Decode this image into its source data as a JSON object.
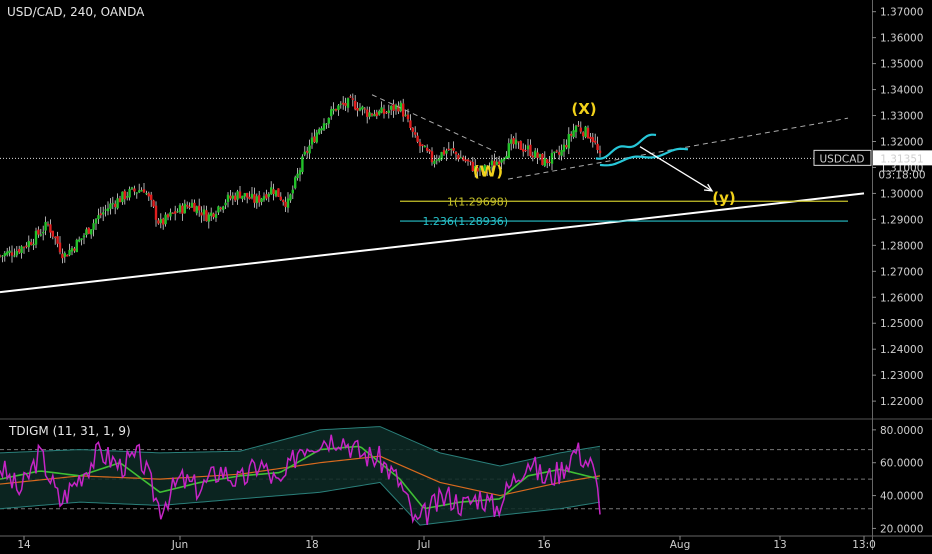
{
  "header": {
    "symbol_line": "USD/CAD, 240, OANDA"
  },
  "price_tag": {
    "symbol": "USDCAD",
    "value": "1.31351",
    "countdown": "03:18:00"
  },
  "oscillator": {
    "label": "TDIGM (11, 31, 1, 9)"
  },
  "colors": {
    "background": "#000000",
    "up_candle": "#22c12a",
    "down_candle": "#e01e1e",
    "trendline": "#ffffff",
    "fib_1": "#c7c22a",
    "fib_1236": "#27c1c9",
    "wave_label": "#f2d21a",
    "flag": "#27c7d8",
    "rsi_line": "#c624c6",
    "signal_line": "#3fbf34",
    "market_line": "#d86a1e",
    "band": "#2a7f7a"
  },
  "chart_data": [
    {
      "type": "candlestick",
      "title": "USD/CAD, 240, OANDA",
      "timeframe": "240",
      "ylim": [
        1.2135,
        1.3745
      ],
      "y_ticks": [
        "1.37000",
        "1.36000",
        "1.35000",
        "1.34000",
        "1.33000",
        "1.32000",
        "1.31000",
        "1.30000",
        "1.29000",
        "1.28000",
        "1.27000",
        "1.26000",
        "1.25000",
        "1.24000",
        "1.23000",
        "1.22000"
      ],
      "x_ticks": [
        "14",
        "Jun",
        "18",
        "Jul",
        "16",
        "Aug",
        "13",
        "13:0"
      ],
      "last_price": 1.31351,
      "close_path": [
        {
          "x": 0,
          "y": 1.276
        },
        {
          "x": 4,
          "y": 1.278
        },
        {
          "x": 8,
          "y": 1.282
        },
        {
          "x": 12,
          "y": 1.288
        },
        {
          "x": 16,
          "y": 1.276
        },
        {
          "x": 20,
          "y": 1.282
        },
        {
          "x": 24,
          "y": 1.29
        },
        {
          "x": 28,
          "y": 1.296
        },
        {
          "x": 32,
          "y": 1.3
        },
        {
          "x": 36,
          "y": 1.302
        },
        {
          "x": 40,
          "y": 1.288
        },
        {
          "x": 44,
          "y": 1.293
        },
        {
          "x": 48,
          "y": 1.296
        },
        {
          "x": 52,
          "y": 1.291
        },
        {
          "x": 56,
          "y": 1.297
        },
        {
          "x": 60,
          "y": 1.3
        },
        {
          "x": 64,
          "y": 1.297
        },
        {
          "x": 68,
          "y": 1.302
        },
        {
          "x": 72,
          "y": 1.296
        },
        {
          "x": 76,
          "y": 1.314
        },
        {
          "x": 80,
          "y": 1.326
        },
        {
          "x": 84,
          "y": 1.333
        },
        {
          "x": 88,
          "y": 1.335
        },
        {
          "x": 92,
          "y": 1.331
        },
        {
          "x": 96,
          "y": 1.331
        },
        {
          "x": 100,
          "y": 1.334
        },
        {
          "x": 104,
          "y": 1.32
        },
        {
          "x": 108,
          "y": 1.313
        },
        {
          "x": 112,
          "y": 1.317
        },
        {
          "x": 116,
          "y": 1.313
        },
        {
          "x": 120,
          "y": 1.308
        },
        {
          "x": 124,
          "y": 1.312
        },
        {
          "x": 128,
          "y": 1.319
        },
        {
          "x": 132,
          "y": 1.317
        },
        {
          "x": 136,
          "y": 1.312
        },
        {
          "x": 140,
          "y": 1.315
        },
        {
          "x": 144,
          "y": 1.326
        },
        {
          "x": 148,
          "y": 1.322
        },
        {
          "x": 150,
          "y": 1.3135
        }
      ],
      "annotations": [
        {
          "text": "(W)",
          "kind": "wave",
          "x": 122,
          "y": 1.3065
        },
        {
          "text": "(X)",
          "kind": "wave",
          "x": 146,
          "y": 1.3305
        },
        {
          "text": "(y)",
          "kind": "wave",
          "x": 181,
          "y": 1.2963
        },
        {
          "text": "1(1.29698)",
          "kind": "fib",
          "level": 1.29698
        },
        {
          "text": "1.236(1.28936)",
          "kind": "fib",
          "level": 1.28936
        }
      ],
      "lines": {
        "support_trendline": [
          {
            "x": 0,
            "y": 1.262
          },
          {
            "x": 216,
            "y": 1.3
          }
        ],
        "upper_dashed": [
          {
            "x": 93,
            "y": 1.338
          },
          {
            "x": 124,
            "y": 1.316
          }
        ],
        "lower_dashed": [
          {
            "x": 127,
            "y": 1.3055
          },
          {
            "x": 212,
            "y": 1.329
          }
        ],
        "fib_1_range": [
          100,
          212
        ],
        "fib_1236_range": [
          100,
          212
        ],
        "projection_arrow": [
          {
            "x": 160,
            "y": 1.318
          },
          {
            "x": 178,
            "y": 1.301
          }
        ],
        "flag_upper": [
          {
            "x": 149,
            "y": 1.3135
          },
          {
            "x": 164,
            "y": 1.3225
          }
        ],
        "flag_lower": [
          {
            "x": 150,
            "y": 1.311
          },
          {
            "x": 172,
            "y": 1.317
          }
        ]
      }
    },
    {
      "type": "line",
      "title": "TDIGM (11, 31, 1, 9)",
      "ylim": [
        16,
        86
      ],
      "y_ticks": [
        "80.0000",
        "60.0000",
        "40.0000",
        "20.0000"
      ],
      "reference_levels": [
        68,
        50,
        32
      ],
      "series": [
        {
          "role": "rsi",
          "values": [
            {
              "x": 0,
              "y": 58
            },
            {
              "x": 5,
              "y": 42
            },
            {
              "x": 10,
              "y": 66
            },
            {
              "x": 15,
              "y": 36
            },
            {
              "x": 20,
              "y": 52
            },
            {
              "x": 25,
              "y": 67
            },
            {
              "x": 30,
              "y": 58
            },
            {
              "x": 35,
              "y": 64
            },
            {
              "x": 40,
              "y": 32
            },
            {
              "x": 45,
              "y": 50
            },
            {
              "x": 50,
              "y": 44
            },
            {
              "x": 55,
              "y": 56
            },
            {
              "x": 60,
              "y": 48
            },
            {
              "x": 65,
              "y": 60
            },
            {
              "x": 70,
              "y": 45
            },
            {
              "x": 75,
              "y": 70
            },
            {
              "x": 80,
              "y": 74
            },
            {
              "x": 85,
              "y": 76
            },
            {
              "x": 90,
              "y": 66
            },
            {
              "x": 95,
              "y": 62
            },
            {
              "x": 100,
              "y": 48
            },
            {
              "x": 104,
              "y": 22
            },
            {
              "x": 108,
              "y": 33
            },
            {
              "x": 112,
              "y": 40
            },
            {
              "x": 116,
              "y": 34
            },
            {
              "x": 120,
              "y": 40
            },
            {
              "x": 124,
              "y": 32
            },
            {
              "x": 128,
              "y": 48
            },
            {
              "x": 132,
              "y": 62
            },
            {
              "x": 136,
              "y": 50
            },
            {
              "x": 140,
              "y": 55
            },
            {
              "x": 144,
              "y": 68
            },
            {
              "x": 148,
              "y": 58
            },
            {
              "x": 150,
              "y": 36
            }
          ]
        },
        {
          "role": "signal",
          "values": [
            {
              "x": 0,
              "y": 50
            },
            {
              "x": 10,
              "y": 55
            },
            {
              "x": 20,
              "y": 52
            },
            {
              "x": 30,
              "y": 60
            },
            {
              "x": 40,
              "y": 42
            },
            {
              "x": 50,
              "y": 48
            },
            {
              "x": 60,
              "y": 52
            },
            {
              "x": 70,
              "y": 54
            },
            {
              "x": 80,
              "y": 68
            },
            {
              "x": 90,
              "y": 70
            },
            {
              "x": 100,
              "y": 50
            },
            {
              "x": 106,
              "y": 32
            },
            {
              "x": 115,
              "y": 36
            },
            {
              "x": 125,
              "y": 38
            },
            {
              "x": 132,
              "y": 52
            },
            {
              "x": 140,
              "y": 56
            },
            {
              "x": 150,
              "y": 50
            }
          ]
        },
        {
          "role": "market_base",
          "values": [
            {
              "x": 0,
              "y": 47
            },
            {
              "x": 20,
              "y": 52
            },
            {
              "x": 40,
              "y": 50
            },
            {
              "x": 60,
              "y": 53
            },
            {
              "x": 80,
              "y": 60
            },
            {
              "x": 95,
              "y": 64
            },
            {
              "x": 110,
              "y": 48
            },
            {
              "x": 125,
              "y": 40
            },
            {
              "x": 140,
              "y": 48
            },
            {
              "x": 150,
              "y": 52
            }
          ]
        },
        {
          "role": "upper_band",
          "values": [
            {
              "x": 0,
              "y": 66
            },
            {
              "x": 20,
              "y": 68
            },
            {
              "x": 40,
              "y": 66
            },
            {
              "x": 60,
              "y": 67
            },
            {
              "x": 80,
              "y": 80
            },
            {
              "x": 95,
              "y": 82
            },
            {
              "x": 110,
              "y": 66
            },
            {
              "x": 125,
              "y": 58
            },
            {
              "x": 140,
              "y": 66
            },
            {
              "x": 150,
              "y": 70
            }
          ]
        },
        {
          "role": "lower_band",
          "values": [
            {
              "x": 0,
              "y": 32
            },
            {
              "x": 20,
              "y": 36
            },
            {
              "x": 40,
              "y": 34
            },
            {
              "x": 60,
              "y": 38
            },
            {
              "x": 80,
              "y": 42
            },
            {
              "x": 95,
              "y": 48
            },
            {
              "x": 105,
              "y": 22
            },
            {
              "x": 125,
              "y": 28
            },
            {
              "x": 140,
              "y": 32
            },
            {
              "x": 150,
              "y": 36
            }
          ]
        }
      ]
    }
  ]
}
